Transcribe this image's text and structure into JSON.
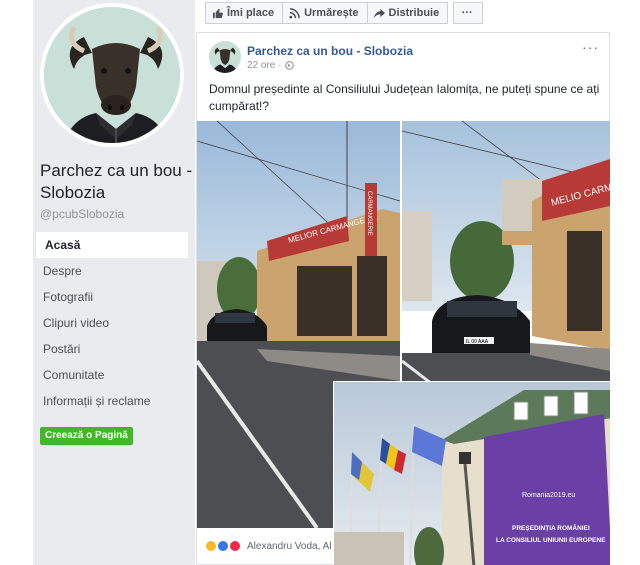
{
  "page": {
    "name": "Parchez ca un bou - Slobozia",
    "handle": "@pcubSlobozia"
  },
  "nav": {
    "items": [
      {
        "label": "Acasă"
      },
      {
        "label": "Despre"
      },
      {
        "label": "Fotografii"
      },
      {
        "label": "Clipuri video"
      },
      {
        "label": "Postări"
      },
      {
        "label": "Comunitate"
      },
      {
        "label": "Informații și reclame"
      }
    ],
    "create_page": "Creează o Pagină"
  },
  "actions": {
    "like": "Îmi place",
    "follow": "Urmărește",
    "share": "Distribuie",
    "more": "···"
  },
  "post": {
    "author": "Parchez ca un bou - Slobozia",
    "time": "22 ore ·",
    "menu": "···",
    "text": "Domnul președinte al Consiliului Județean Ialomița, ne puteți spune ce ați cumpărat!?",
    "reactions_text": "Alexandru Voda, Al"
  },
  "photos": {
    "shop_sign": "MELIOR CARMANGERIE",
    "shop_sign_vertical": "CARMANGERIE",
    "shop_sign_2": "MELIO CARMANG",
    "plate": "IL 00 AAA",
    "banner_site": "Romania2019.eu",
    "banner_line1": "PREȘEDINȚIA ROMÂNIEI",
    "banner_line2": "LA CONSILIUL UNIUNII EUROPENE"
  },
  "colors": {
    "link": "#365899",
    "create_button": "#42b72a",
    "sidebar_bg": "#e9ebee",
    "banner_purple": "#6a3fa6"
  }
}
